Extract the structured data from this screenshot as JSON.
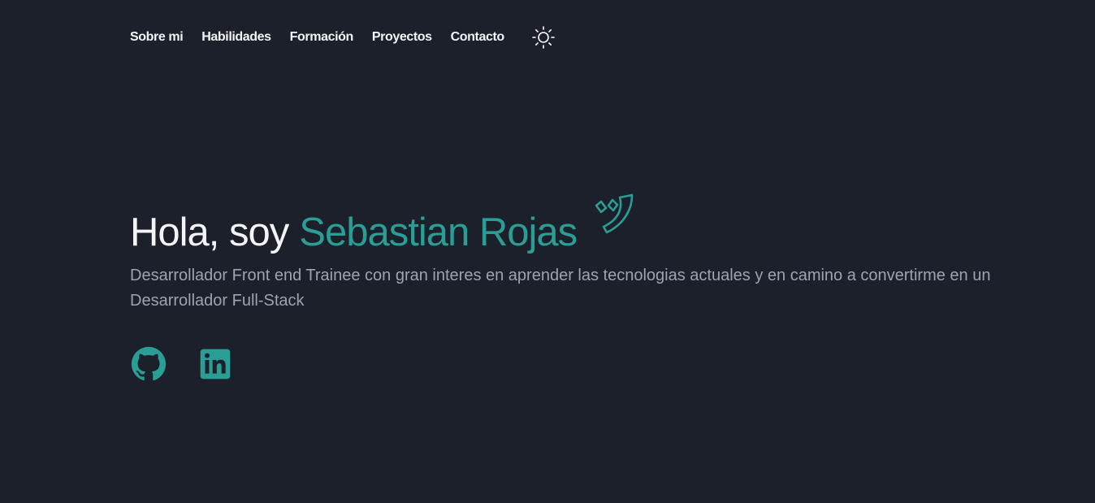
{
  "nav": {
    "items": [
      "Sobre mi",
      "Habilidades",
      "Formación",
      "Proyectos",
      "Contacto"
    ],
    "theme_icon": "sun-icon"
  },
  "hero": {
    "greeting": "Hola, soy",
    "name": "Sebastian Rojas",
    "wave_icon": "wave-icon",
    "description": "Desarrollador Front end Trainee con gran interes en aprender las tecnologias actuales y en camino a convertirme en un Desarrollador Full-Stack"
  },
  "socials": {
    "github_icon": "github-icon",
    "linkedin_icon": "linkedin-icon"
  },
  "colors": {
    "background": "#1c202b",
    "accent": "#2a9d95",
    "text": "#f3f4f6",
    "muted": "#9ca3b0"
  }
}
